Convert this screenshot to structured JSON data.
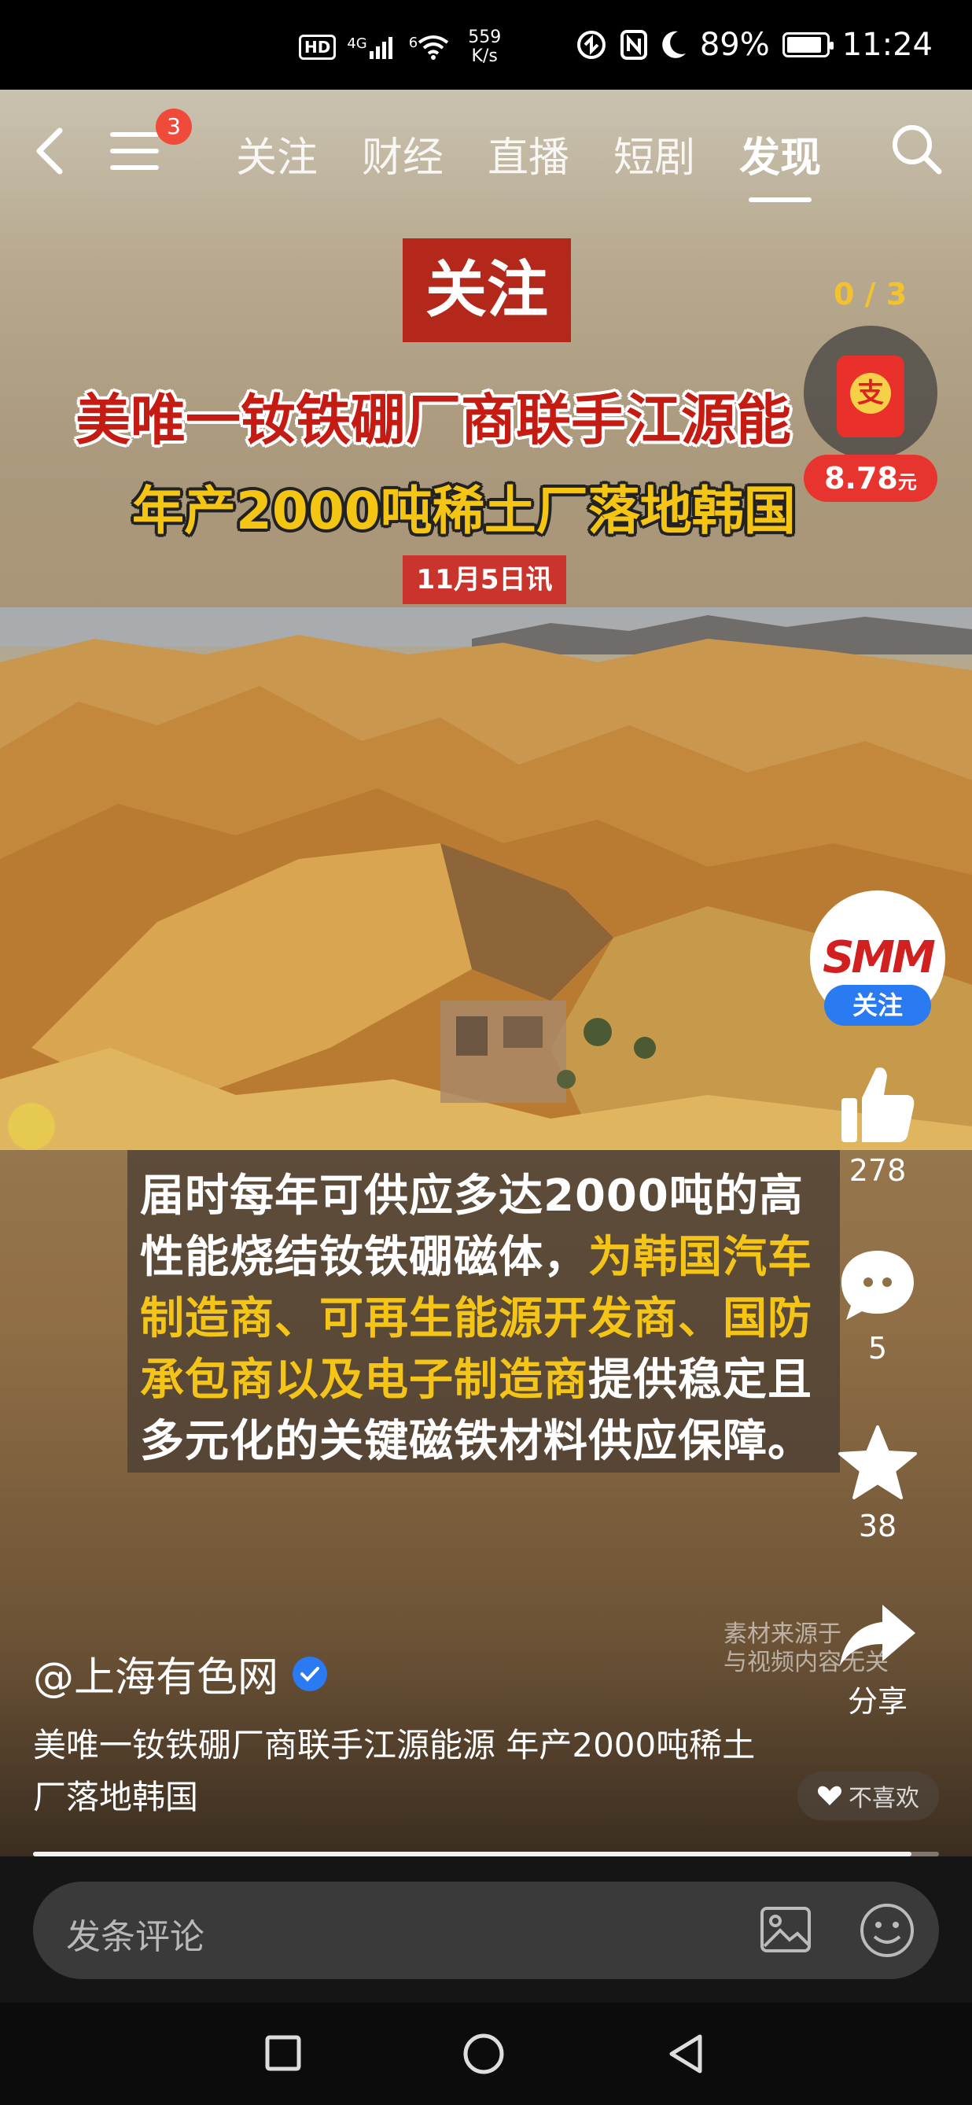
{
  "status_bar": {
    "network_speed_value": "559",
    "network_speed_unit": "K/s",
    "signal_label": "4G",
    "wifi_label": "6",
    "hd_label": "HD",
    "battery": "89%",
    "battery_level": 0.89,
    "time": "11:24"
  },
  "nav": {
    "badge_count": "3",
    "tabs": [
      {
        "label": "关注"
      },
      {
        "label": "财经"
      },
      {
        "label": "直播"
      },
      {
        "label": "短剧"
      },
      {
        "label": "发现"
      }
    ],
    "active_tab": "发现"
  },
  "video": {
    "follow_banner": "关注",
    "headline_line1": "美唯一钕铁硼厂商联手江源能",
    "headline_line2": "年产2000吨稀土厂落地韩国",
    "date_tag": "11月5日讯",
    "subtitle_white_1": "届时每年可供应多达2000吨的高性能烧结钕铁硼磁体，",
    "subtitle_yellow": "为韩国汽车制造商、可再生能源开发商、国防承包商以及电子制造商",
    "subtitle_white_2": "提供稳定且多元化的关键磁铁材料供应保障。",
    "source_note_1": "素材来源于",
    "source_note_2": "与视频内容无关"
  },
  "red_packet": {
    "progress": "0 / 3",
    "envelope_glyph": "支",
    "amount": "8.78",
    "unit": "元"
  },
  "rail": {
    "avatar_logo": "SMM",
    "avatar_sub": "上海有色网",
    "follow_label": "关注",
    "likes": "278",
    "comments": "5",
    "favorites": "38",
    "share_label": "分享"
  },
  "post": {
    "author": "@上海有色网",
    "description": "美唯一钕铁硼厂商联手江源能源 年产2000吨稀土厂落地韩国",
    "dislike_label": "不喜欢",
    "progress_fraction": 0.97
  },
  "comment_bar": {
    "placeholder": "发条评论"
  }
}
